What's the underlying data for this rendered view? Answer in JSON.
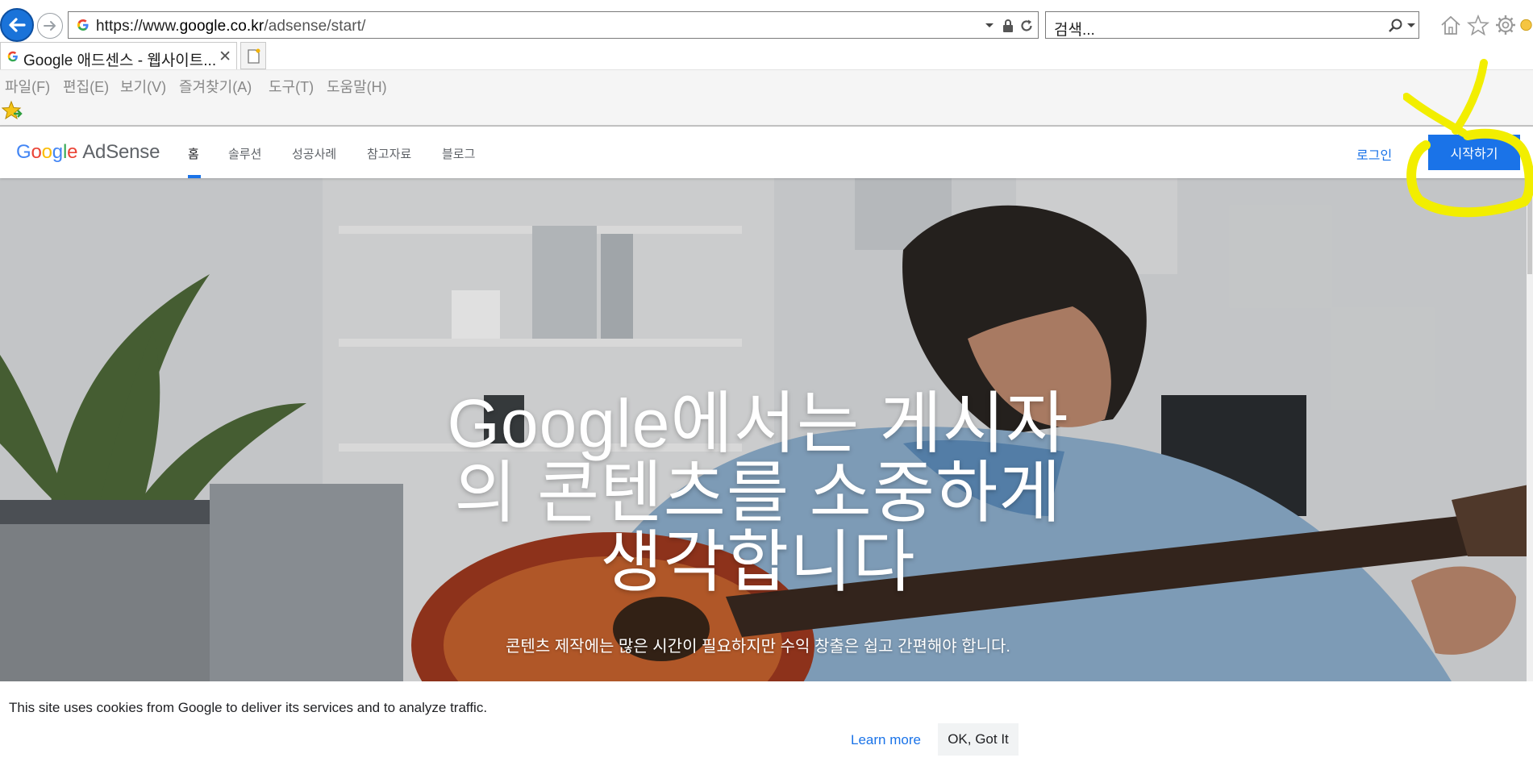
{
  "browser": {
    "address_bar": {
      "url_scheme": "https://www.",
      "url_host": "google.co.kr",
      "url_path": "/adsense/start/"
    },
    "search_box": {
      "placeholder": "검색..."
    },
    "tabs": [
      {
        "title": "Google 애드센스 - 웹사이트...",
        "active": true
      }
    ],
    "menu": [
      {
        "label": "파일(F)"
      },
      {
        "label": "편집(E)"
      },
      {
        "label": "보기(V)"
      },
      {
        "label": "즐겨찾기(A)"
      },
      {
        "label": "도구(T)"
      },
      {
        "label": "도움말(H)"
      }
    ],
    "icons": [
      "back-arrow-icon",
      "forward-arrow-icon",
      "google-favicon",
      "dropdown-icon",
      "lock-icon",
      "refresh-icon",
      "search-icon",
      "home-icon",
      "star-icon",
      "gear-icon",
      "new-tab-icon",
      "favorites-star-icon"
    ]
  },
  "site": {
    "logo": {
      "google": "Google",
      "product": "AdSense"
    },
    "nav": [
      {
        "label": "홈",
        "active": true
      },
      {
        "label": "솔루션"
      },
      {
        "label": "성공사례"
      },
      {
        "label": "참고자료"
      },
      {
        "label": "블로그"
      }
    ],
    "login_label": "로그인",
    "start_label": "시작하기",
    "accent_color": "#1a73e8"
  },
  "hero": {
    "title_line1": "Google에서는 게시자",
    "title_line2": "의 콘텐츠를 소중하게",
    "title_line3": "생각합니다",
    "subtitle": "콘텐츠 제작에는 많은 시간이 필요하지만 수익 창출은 쉽고 간편해야 합니다."
  },
  "cookie_bar": {
    "message": "This site uses cookies from Google to deliver its services and to analyze traffic.",
    "learn_more": "Learn more",
    "ok": "OK, Got It"
  },
  "annotation": {
    "color": "#f2ee00"
  }
}
